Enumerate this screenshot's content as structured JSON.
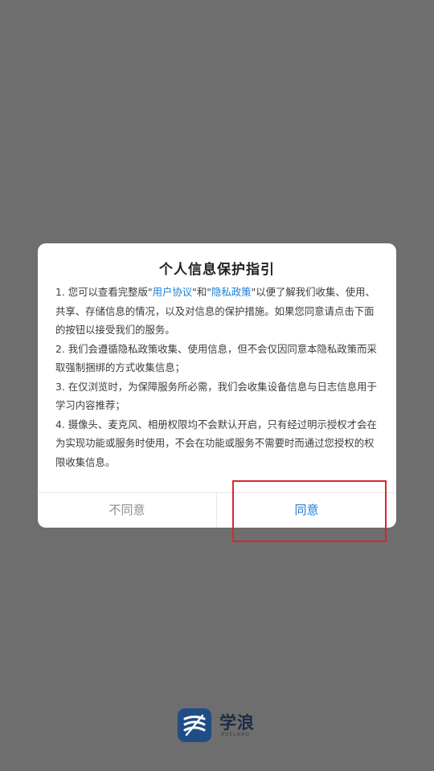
{
  "dialog": {
    "title": "个人信息保护指引",
    "paragraphs": [
      {
        "before": "1. 您可以查看完整版\"",
        "link1": "用户协议",
        "middle": "\"和\"",
        "link2": "隐私政策",
        "after": "\"以便了解我们收集、使用、共享、存储信息的情况，以及对信息的保护措施。如果您同意请点击下面的按钮以接受我们的服务。"
      },
      {
        "text": "2. 我们会遵循隐私政策收集、使用信息，但不会仅因同意本隐私政策而采取强制捆绑的方式收集信息；"
      },
      {
        "text": "3. 在仅浏览时，为保障服务所必需，我们会收集设备信息与日志信息用于学习内容推荐；"
      },
      {
        "text": "4. 摄像头、麦克风、相册权限均不会默认开启，只有经过明示授权才会在为实现功能或服务时使用，不会在功能或服务不需要时而通过您授权的权限收集信息。"
      }
    ],
    "disagree_label": "不同意",
    "agree_label": "同意"
  },
  "brand": {
    "icon": "xuelang-logo-icon",
    "name": "学浪",
    "sub": "XUELANG"
  },
  "colors": {
    "overlay": "#6e6e6e",
    "link": "#1c7ed6",
    "agree": "#1c7ed6",
    "disagree": "#8e8e8e",
    "highlight": "#d9262c",
    "brand_icon_bg": "#1f4d86"
  }
}
